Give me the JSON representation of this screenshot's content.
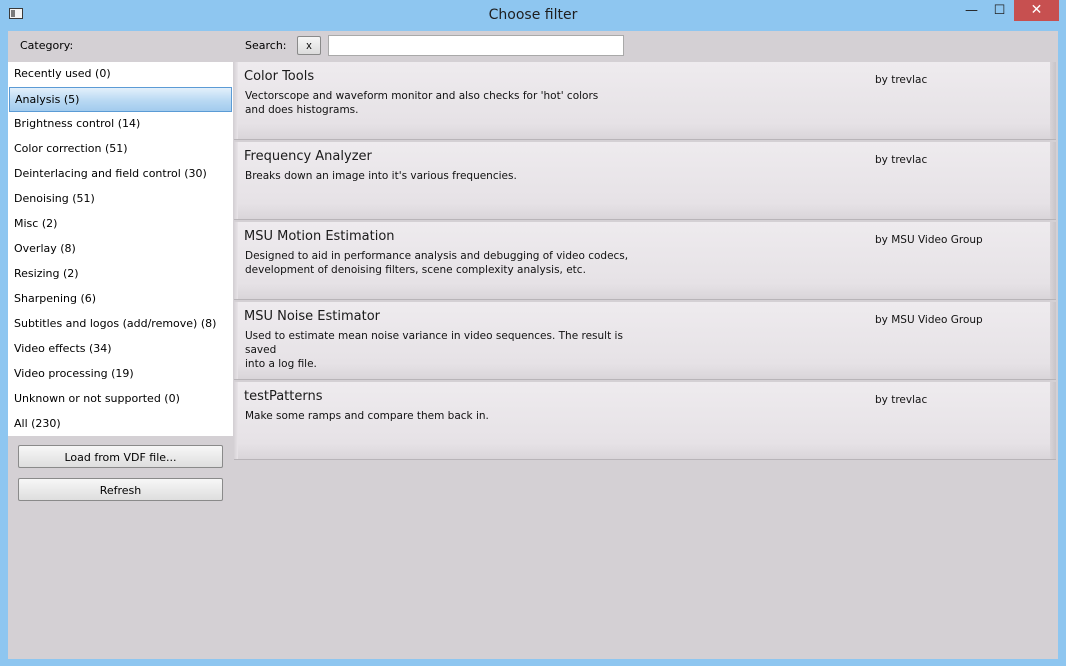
{
  "window": {
    "title": "Choose filter",
    "controls": {
      "minimize": "—",
      "maximize": "☐",
      "close": "✕"
    }
  },
  "category": {
    "label": "Category:",
    "items": [
      {
        "label": "Recently used (0)",
        "selected": false
      },
      {
        "label": "Analysis (5)",
        "selected": true
      },
      {
        "label": "Brightness control (14)",
        "selected": false
      },
      {
        "label": "Color correction (51)",
        "selected": false
      },
      {
        "label": "Deinterlacing and field control (30)",
        "selected": false
      },
      {
        "label": "Denoising (51)",
        "selected": false
      },
      {
        "label": "Misc (2)",
        "selected": false
      },
      {
        "label": "Overlay (8)",
        "selected": false
      },
      {
        "label": "Resizing (2)",
        "selected": false
      },
      {
        "label": "Sharpening (6)",
        "selected": false
      },
      {
        "label": "Subtitles and logos (add/remove) (8)",
        "selected": false
      },
      {
        "label": "Video effects (34)",
        "selected": false
      },
      {
        "label": "Video processing (19)",
        "selected": false
      },
      {
        "label": "Unknown or not supported (0)",
        "selected": false
      },
      {
        "label": "All (230)",
        "selected": false
      }
    ]
  },
  "search": {
    "label": "Search:",
    "clear_label": "x",
    "value": "",
    "placeholder": ""
  },
  "buttons": {
    "load": "Load from VDF file...",
    "refresh": "Refresh"
  },
  "filters": [
    {
      "name": "Color Tools",
      "description": "Vectorscope and waveform monitor and also checks for 'hot' colors\nand does histograms.",
      "author": "by trevlac"
    },
    {
      "name": "Frequency Analyzer",
      "description": "Breaks down an image into it's various frequencies.",
      "author": "by trevlac"
    },
    {
      "name": "MSU Motion Estimation",
      "description": "Designed to aid in performance analysis and debugging of video codecs,\ndevelopment of denoising filters, scene complexity analysis, etc.",
      "author": "by MSU Video Group"
    },
    {
      "name": "MSU Noise Estimator",
      "description": "Used to estimate mean noise variance in video sequences. The result is saved\ninto a log file.",
      "author": "by MSU Video Group"
    },
    {
      "name": "testPatterns",
      "description": "Make some ramps and compare them back in.",
      "author": "by trevlac"
    }
  ],
  "colors": {
    "titlebar": "#8ec6f0",
    "client": "#d4d0d4",
    "close": "#c75050",
    "selection": "#b9d9f3"
  }
}
